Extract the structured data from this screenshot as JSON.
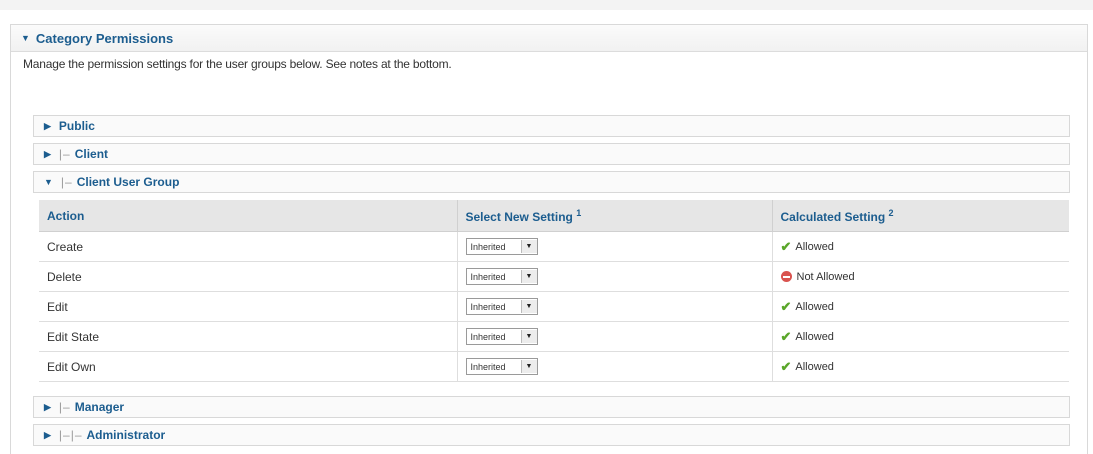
{
  "panel": {
    "title": "Category Permissions",
    "intro": "Manage the permission settings for the user groups below. See notes at the bottom."
  },
  "groups": {
    "public": {
      "label": "Public",
      "prefix": ""
    },
    "client": {
      "label": "Client",
      "prefix": "|–"
    },
    "client_user_group": {
      "label": "Client User Group",
      "prefix": "|–"
    },
    "manager": {
      "label": "Manager",
      "prefix": "|–"
    },
    "administrator": {
      "label": "Administrator",
      "prefix": "|–|–"
    }
  },
  "table": {
    "headers": {
      "action": "Action",
      "select": "Select New Setting",
      "select_note": "1",
      "calculated": "Calculated Setting",
      "calculated_note": "2"
    },
    "rows": [
      {
        "action": "Create",
        "setting": "Inherited",
        "calculated": "Allowed",
        "status": "allowed"
      },
      {
        "action": "Delete",
        "setting": "Inherited",
        "calculated": "Not Allowed",
        "status": "denied"
      },
      {
        "action": "Edit",
        "setting": "Inherited",
        "calculated": "Allowed",
        "status": "allowed"
      },
      {
        "action": "Edit State",
        "setting": "Inherited",
        "calculated": "Allowed",
        "status": "allowed"
      },
      {
        "action": "Edit Own",
        "setting": "Inherited",
        "calculated": "Allowed",
        "status": "allowed"
      }
    ]
  },
  "icons": {
    "collapse": "triangle-down-icon",
    "expand": "triangle-right-icon",
    "allowed": "check-icon",
    "denied": "not-allowed-icon",
    "dropdown": "dropdown-arrow-icon"
  },
  "colors": {
    "link_blue": "#1c5d8f",
    "allowed_green": "#5aa62a",
    "denied_red": "#d9534f",
    "header_gray": "#e6e6e6"
  }
}
